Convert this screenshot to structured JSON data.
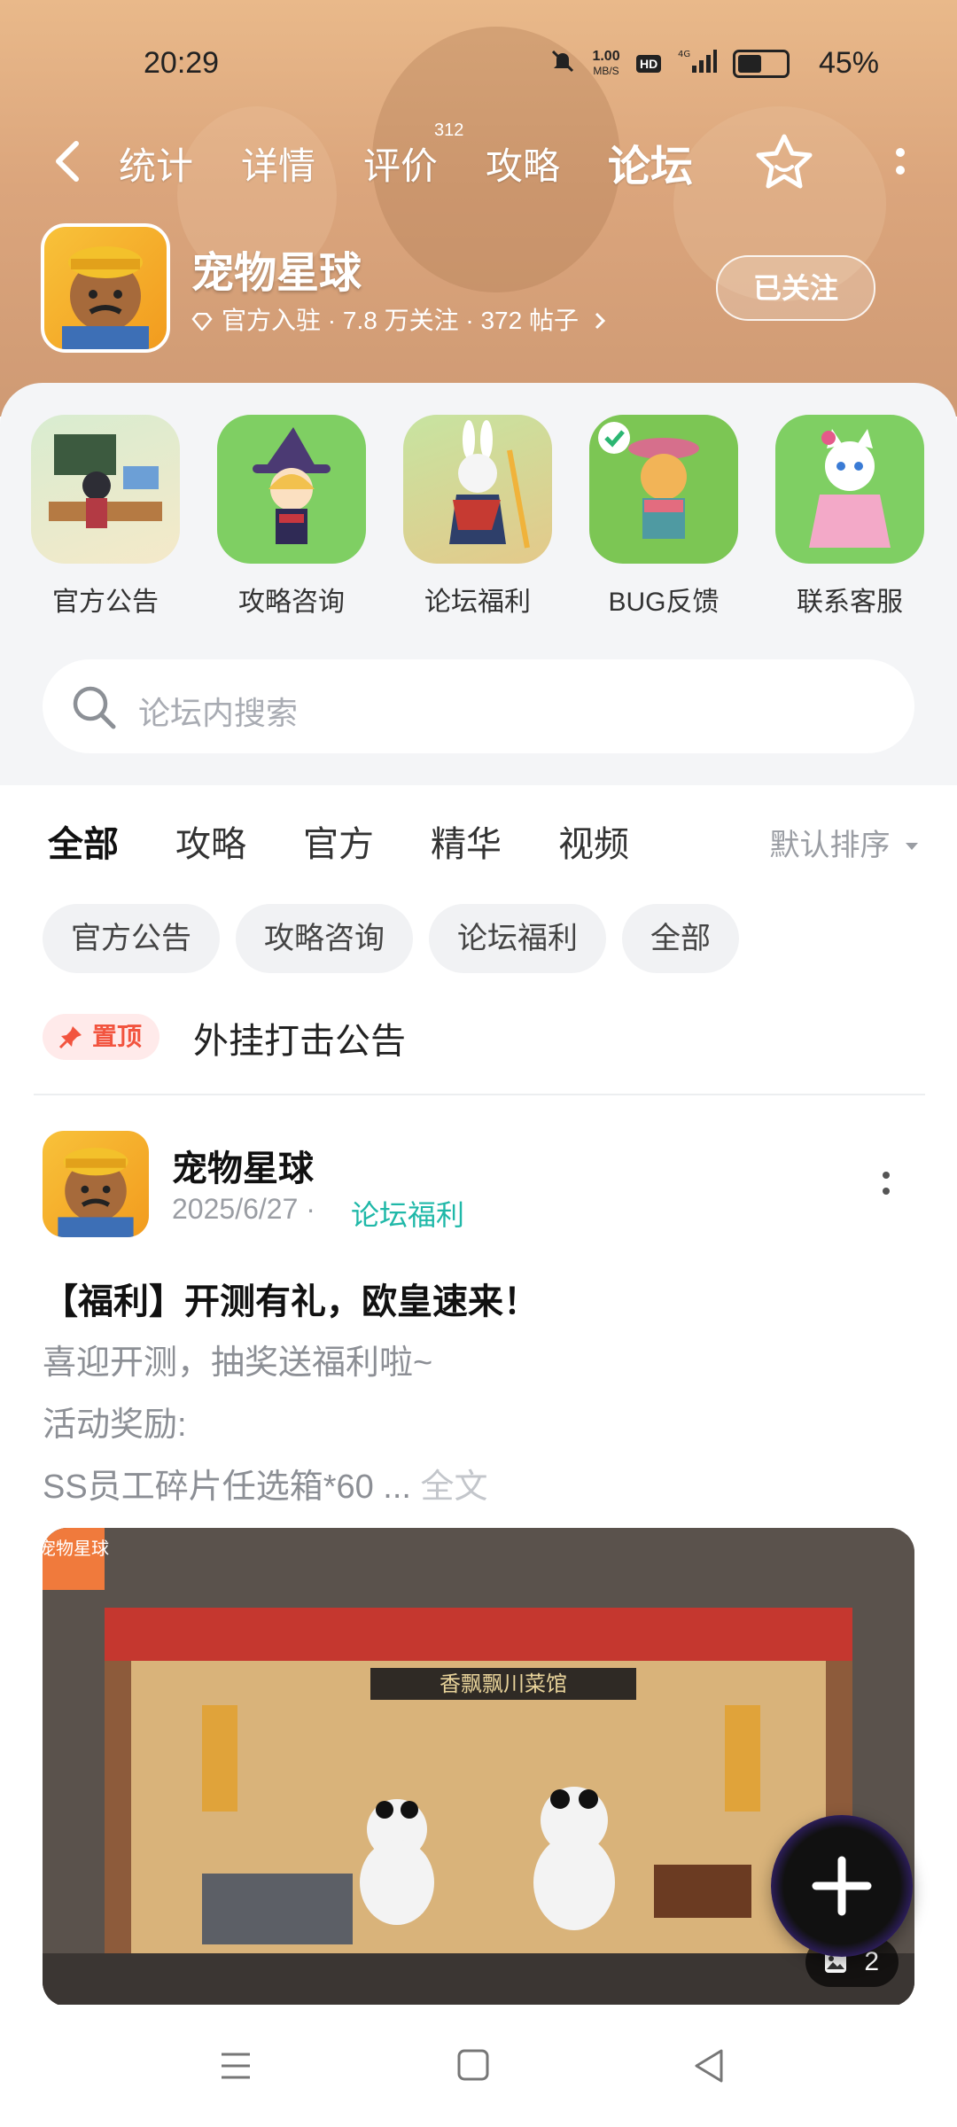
{
  "status_bar": {
    "time": "20:29",
    "net_speed_top": "1.00",
    "net_speed_unit": "MB/S",
    "hd": "HD",
    "network": "4G",
    "battery": "45%"
  },
  "top_nav": {
    "tabs": [
      {
        "label": "统计"
      },
      {
        "label": "详情"
      },
      {
        "label": "评价",
        "count": "312"
      },
      {
        "label": "攻略"
      },
      {
        "label": "论坛"
      }
    ],
    "active_tab": "论坛"
  },
  "game": {
    "name": "宠物星球",
    "meta": "官方入驻 · 7.8 万关注 · 372 帖子",
    "follow_label": "已关注"
  },
  "categories": [
    {
      "label": "官方公告"
    },
    {
      "label": "攻略咨询"
    },
    {
      "label": "论坛福利"
    },
    {
      "label": "BUG反馈"
    },
    {
      "label": "联系客服"
    }
  ],
  "search": {
    "placeholder": "论坛内搜索"
  },
  "filter_tabs": [
    {
      "label": "全部"
    },
    {
      "label": "攻略"
    },
    {
      "label": "官方"
    },
    {
      "label": "精华"
    },
    {
      "label": "视频"
    }
  ],
  "sort_label": "默认排序",
  "chips": [
    "官方公告",
    "攻略咨询",
    "论坛福利",
    "全部"
  ],
  "pinned": {
    "badge": "置顶",
    "title": "外挂打击公告"
  },
  "post": {
    "author": "宠物星球",
    "date": "2025/6/27 ·",
    "tag": "论坛福利",
    "title": "【福利】开测有礼，欧皇速来！",
    "line1": "喜迎开测，抽奖送福利啦~",
    "line2": "活动奖励:",
    "line3": "SS员工碎片任选箱*60 ...",
    "fulltext": "全文",
    "image_count": "2",
    "image_watermark": "宠物星球",
    "image_sign": "香飘飘川菜馆"
  },
  "colors": {
    "accent": "#1fc6b5",
    "pin": "#f2543f"
  }
}
